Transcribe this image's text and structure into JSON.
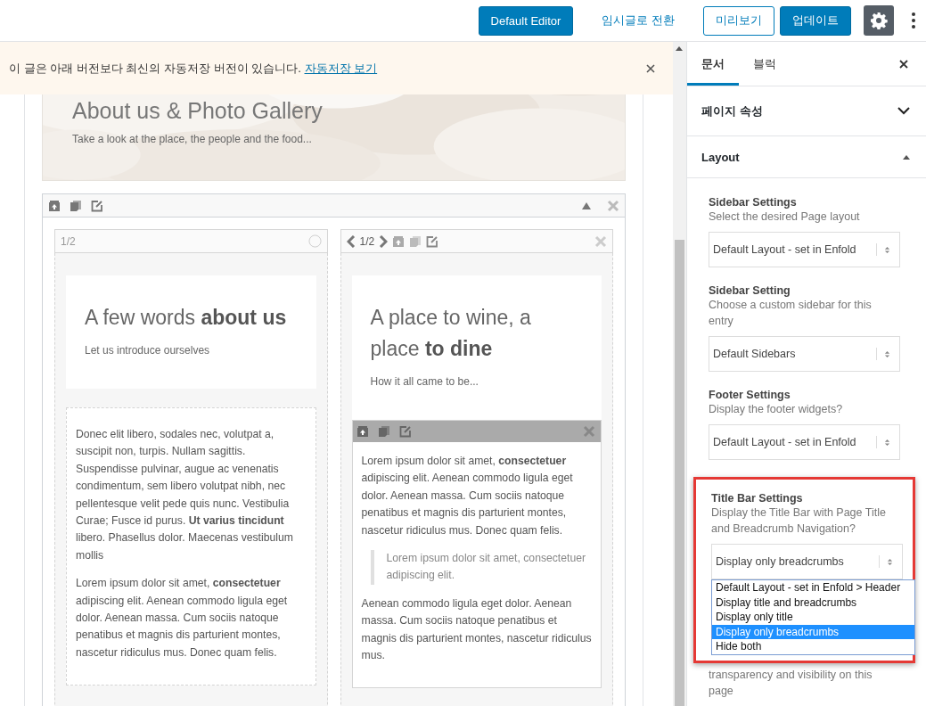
{
  "toolbar": {
    "buttons": [
      {
        "kind": "primary",
        "label": "Default Editor"
      },
      {
        "kind": "link",
        "label": "임시글로 전환"
      },
      {
        "kind": "outline",
        "label": "미리보기"
      },
      {
        "kind": "primary",
        "label": "업데이트"
      },
      {
        "kind": "settings",
        "pressed": true
      },
      {
        "kind": "more"
      }
    ]
  },
  "notice": {
    "text": "이 글은 아래 버전보다 최신의 자동저장 버전이 있습니다.",
    "link": "자동저장 보기"
  },
  "hero": {
    "kind": "picture",
    "title": "About us & Photo Gallery",
    "subtitle": "Take a look at the place, the people and the food..."
  },
  "columns": [
    {
      "header": {
        "kind": "plain",
        "fraction": "1/2"
      },
      "blocks": [
        {
          "kind": "heading",
          "title": "A few words **about us**",
          "subtitle": "Let us introduce ourselves"
        },
        {
          "kind": "text",
          "toolbar": false,
          "content": [
            {
              "kind": "paragraph",
              "text": "Donec elit libero, sodales nec, volutpat a, suscipit non, turpis. Nullam sagittis. Suspendisse pulvinar, augue ac venenatis condimentum, sem libero volutpat nibh, nec pellentesque velit pede quis nunc. Vestibulia Curae; Fusce id purus. **Ut varius tincidunt** libero. Phasellus dolor. Maecenas vestibulum mollis"
            },
            {
              "kind": "paragraph",
              "text": "Lorem ipsum dolor sit amet, **consectetuer** adipiscing elit. Aenean commodo ligula eget dolor. Aenean massa. Cum sociis natoque penatibus et magnis dis parturient montes, nascetur ridiculus mus. Donec quam felis."
            }
          ]
        }
      ]
    },
    {
      "header": {
        "kind": "nav",
        "fraction": "1/2"
      },
      "blocks": [
        {
          "kind": "heading",
          "title": "A place to wine, a place **to dine**",
          "subtitle": "How it all came to be..."
        },
        {
          "kind": "text",
          "toolbar": true,
          "content": [
            {
              "kind": "paragraph",
              "text": "Lorem ipsum dolor sit amet, **consectetuer** adipiscing elit. Aenean commodo ligula eget dolor. Aenean massa. Cum sociis natoque penatibus et magnis dis parturient montes, nascetur ridiculus mus. Donec quam felis."
            },
            {
              "kind": "quote",
              "text": "Lorem ipsum dolor sit amet, consectetuer adipiscing elit."
            },
            {
              "kind": "paragraph",
              "text": "Aenean commodo ligula eget dolor. Aenean massa. Cum sociis natoque penatibus et magnis dis parturient montes, nascetur ridiculus mus."
            }
          ]
        }
      ]
    }
  ],
  "sidebar": {
    "tabs": [
      {
        "label": "문서",
        "selected": true
      },
      {
        "label": "블럭",
        "selected": false
      }
    ],
    "panels": [
      {
        "title": "페이지 속성",
        "expanded": false
      },
      {
        "title": "Layout",
        "expanded": true,
        "settings": [
          {
            "label": "Sidebar Settings",
            "description": "Select the desired Page layout",
            "value": "Default Layout - set in Enfold",
            "highlighted": false
          },
          {
            "label": "Sidebar Setting",
            "description": "Choose a custom sidebar for this entry",
            "value": "Default Sidebars",
            "highlighted": false
          },
          {
            "label": "Footer Settings",
            "description": "Display the footer widgets?",
            "value": "Default Layout - set in Enfold",
            "highlighted": false
          },
          {
            "label": "Title Bar Settings",
            "description": "Display the Title Bar with Page Title and Breadcrumb Navigation?",
            "value": "Display only breadcrumbs",
            "highlighted": true,
            "options": [
              {
                "label": "Default Layout - set in Enfold > Header",
                "selected": false
              },
              {
                "label": "Display title and breadcrumbs",
                "selected": false
              },
              {
                "label": "Display only title",
                "selected": false
              },
              {
                "label": "Display only breadcrumbs",
                "selected": true
              },
              {
                "label": "Hide both",
                "selected": false
              }
            ]
          },
          {
            "description": "transparency and visibility on this page",
            "highlighted": false
          }
        ]
      }
    ]
  }
}
